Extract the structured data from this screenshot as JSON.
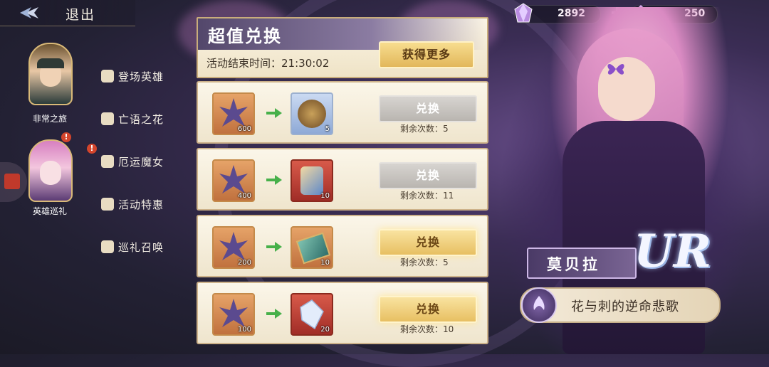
{
  "nav": {
    "exit_label": "退出"
  },
  "currency": {
    "gem": "2892",
    "crystal": "250"
  },
  "characters": [
    {
      "name": "非常之旅"
    },
    {
      "name": "英雄巡礼",
      "alert": "!"
    }
  ],
  "menu": [
    {
      "label": "登场英雄",
      "icon": "cards-icon"
    },
    {
      "label": "亡语之花",
      "icon": "scroll-icon"
    },
    {
      "label": "厄运魔女",
      "icon": "pouch-icon",
      "alert": "!"
    },
    {
      "label": "活动特惠",
      "icon": "gift-icon"
    },
    {
      "label": "巡礼召唤",
      "icon": "pouch-icon"
    }
  ],
  "exchange": {
    "title": "超值兑换",
    "end_time_label": "活动结束时间：",
    "end_time": "21:30:02",
    "more_button": "获得更多",
    "rows": [
      {
        "cost": "600",
        "reward_qty": "5",
        "reward": "hero-medal-icon",
        "button": "兑换",
        "state": "disabled",
        "remaining": "剩余次数：5"
      },
      {
        "cost": "400",
        "reward_qty": "10",
        "reward": "rune-card-icon",
        "button": "兑换",
        "state": "disabled",
        "remaining": "剩余次数：11"
      },
      {
        "cost": "200",
        "reward_qty": "10",
        "reward": "skill-book-icon",
        "button": "兑换",
        "state": "active",
        "remaining": "剩余次数：5"
      },
      {
        "cost": "100",
        "reward_qty": "20",
        "reward": "crystal-shard-icon",
        "button": "兑换",
        "state": "active",
        "remaining": "剩余次数：10"
      }
    ]
  },
  "hero": {
    "name": "莫贝拉",
    "rarity": "UR",
    "skill": "花与刺的逆命悲歌"
  },
  "colors": {
    "gold": "#e7bf62",
    "panel": "#f3ead6",
    "purple": "#53476b",
    "disabled": "#c4c0bb"
  }
}
